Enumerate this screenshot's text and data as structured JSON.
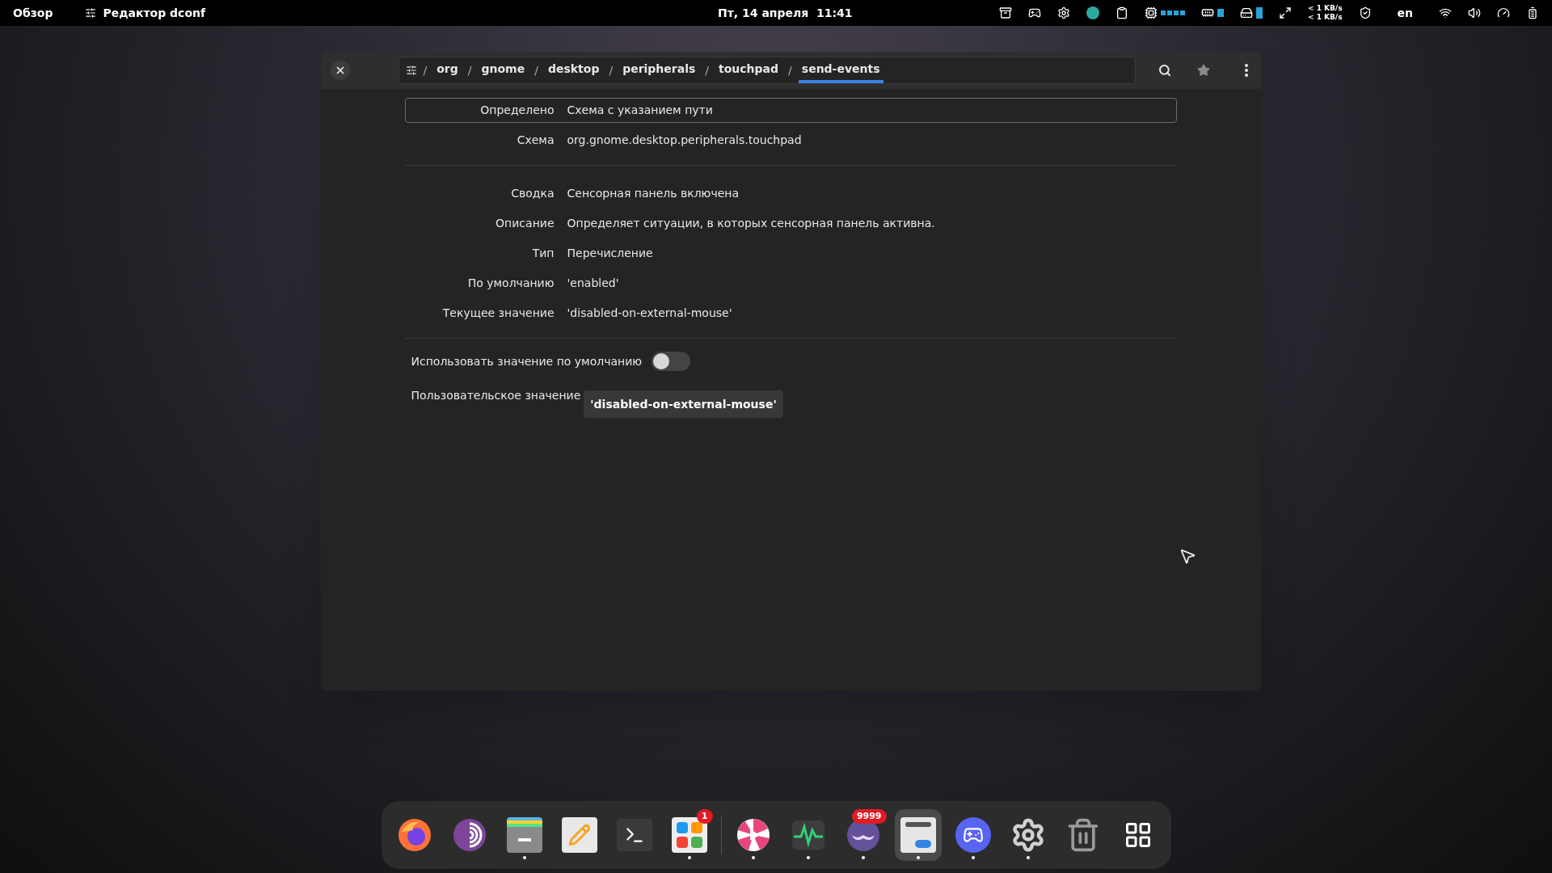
{
  "top_bar": {
    "activities": "Обзор",
    "app_name": "Редактор dconf",
    "clock": "Пт, 14 апреля  11:41",
    "net_up": "< 1 KB/s",
    "net_down": "< 1 KB/s",
    "keyboard_layout": "en"
  },
  "window": {
    "path": [
      {
        "label": "org",
        "selected": false
      },
      {
        "label": "gnome",
        "selected": false
      },
      {
        "label": "desktop",
        "selected": false
      },
      {
        "label": "peripherals",
        "selected": false
      },
      {
        "label": "touchpad",
        "selected": false
      },
      {
        "label": "send-events",
        "selected": true
      }
    ],
    "separator": "/",
    "info_groups": [
      [
        {
          "label": "Определено",
          "value": "Схема с указанием пути",
          "focused": true
        },
        {
          "label": "Схема",
          "value": "org.gnome.desktop.peripherals.touchpad",
          "focused": false
        }
      ],
      [
        {
          "label": "Сводка",
          "value": "Сенсорная панель включена",
          "focused": false
        },
        {
          "label": "Описание",
          "value": "Определяет ситуации, в которых сенсорная панель активна.",
          "focused": false
        },
        {
          "label": "Тип",
          "value": "Перечисление",
          "focused": false
        },
        {
          "label": "По умолчанию",
          "value": "'enabled'",
          "focused": false
        },
        {
          "label": "Текущее значение",
          "value": "'disabled-on-external-mouse'",
          "focused": false
        }
      ]
    ],
    "use_default": {
      "label": "Использовать значение по умолчанию",
      "on": false
    },
    "custom_value": {
      "label": "Пользовательское значение",
      "value": "'disabled-on-external-mouse'"
    }
  },
  "dock": {
    "items": [
      {
        "kind": "firefox",
        "running": false,
        "selected": false
      },
      {
        "kind": "tor",
        "running": false,
        "selected": false
      },
      {
        "kind": "files",
        "running": true,
        "selected": false
      },
      {
        "kind": "editor",
        "running": false,
        "selected": false
      },
      {
        "kind": "terminal",
        "running": false,
        "selected": false
      },
      {
        "kind": "store",
        "running": true,
        "selected": false,
        "badge": "1"
      },
      {
        "kind": "separator"
      },
      {
        "kind": "player",
        "running": true,
        "selected": false
      },
      {
        "kind": "monitor",
        "running": true,
        "selected": false
      },
      {
        "kind": "mustache",
        "running": true,
        "selected": false,
        "badge": "9999"
      },
      {
        "kind": "dconf",
        "running": true,
        "selected": true
      },
      {
        "kind": "discord",
        "running": true,
        "selected": false
      },
      {
        "kind": "settings",
        "running": true,
        "selected": false
      },
      {
        "kind": "trash",
        "running": false,
        "selected": false
      },
      {
        "kind": "grid",
        "running": false,
        "selected": false
      }
    ]
  }
}
